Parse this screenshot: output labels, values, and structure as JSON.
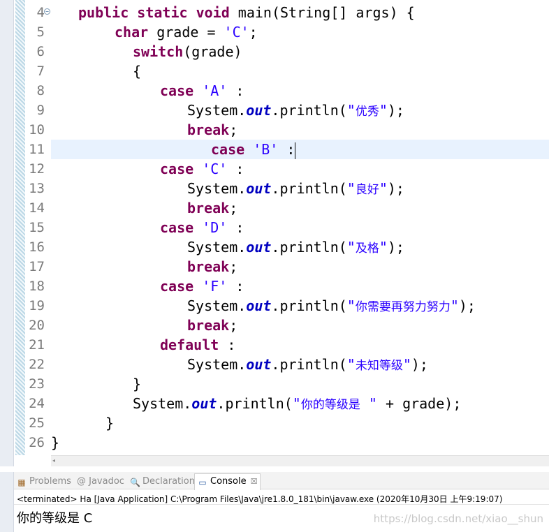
{
  "editor": {
    "lines": [
      {
        "n": "4",
        "indent": 3,
        "tokens": [
          [
            "kw",
            "public"
          ],
          [
            "p",
            " "
          ],
          [
            "kw",
            "static"
          ],
          [
            "p",
            " "
          ],
          [
            "kw",
            "void"
          ],
          [
            "p",
            " main(String[] "
          ],
          [
            "p2",
            "args"
          ],
          [
            "p",
            ") {"
          ]
        ]
      },
      {
        "n": "5",
        "indent": 7,
        "tokens": [
          [
            "kw",
            "char"
          ],
          [
            "p2",
            " grade"
          ],
          [
            "p",
            " = "
          ],
          [
            "str",
            "'C'"
          ],
          [
            "p",
            ";"
          ]
        ]
      },
      {
        "n": "6",
        "indent": 9,
        "tokens": [
          [
            "kw",
            "switch"
          ],
          [
            "p",
            "("
          ],
          [
            "p2",
            "grade"
          ],
          [
            "p",
            ")"
          ]
        ]
      },
      {
        "n": "7",
        "indent": 9,
        "tokens": [
          [
            "p",
            "{"
          ]
        ]
      },
      {
        "n": "8",
        "indent": 12,
        "tokens": [
          [
            "kw",
            "case"
          ],
          [
            "p",
            " "
          ],
          [
            "str",
            "'A'"
          ],
          [
            "p",
            " :"
          ]
        ]
      },
      {
        "n": "9",
        "indent": 15,
        "tokens": [
          [
            "p",
            "System."
          ],
          [
            "fld",
            "out"
          ],
          [
            "p",
            ".println("
          ],
          [
            "str",
            "\""
          ],
          [
            "strcn",
            "优秀"
          ],
          [
            "str",
            "\""
          ],
          [
            "p",
            ");"
          ]
        ]
      },
      {
        "n": "10",
        "indent": 15,
        "tokens": [
          [
            "kw",
            "break"
          ],
          [
            "p",
            ";"
          ]
        ]
      },
      {
        "n": "11",
        "indent": 12,
        "current": true,
        "tokens": [
          [
            "kw",
            "case"
          ],
          [
            "p",
            " "
          ],
          [
            "str",
            "'B'"
          ],
          [
            "p",
            " :"
          ]
        ]
      },
      {
        "n": "12",
        "indent": 12,
        "tokens": [
          [
            "kw",
            "case"
          ],
          [
            "p",
            " "
          ],
          [
            "str",
            "'C'"
          ],
          [
            "p",
            " :"
          ]
        ]
      },
      {
        "n": "13",
        "indent": 15,
        "tokens": [
          [
            "p",
            "System."
          ],
          [
            "fld",
            "out"
          ],
          [
            "p",
            ".println("
          ],
          [
            "str",
            "\""
          ],
          [
            "strcn",
            "良好"
          ],
          [
            "str",
            "\""
          ],
          [
            "p",
            ");"
          ]
        ]
      },
      {
        "n": "14",
        "indent": 15,
        "tokens": [
          [
            "kw",
            "break"
          ],
          [
            "p",
            ";"
          ]
        ]
      },
      {
        "n": "15",
        "indent": 12,
        "tokens": [
          [
            "kw",
            "case"
          ],
          [
            "p",
            " "
          ],
          [
            "str",
            "'D'"
          ],
          [
            "p",
            " :"
          ]
        ]
      },
      {
        "n": "16",
        "indent": 15,
        "tokens": [
          [
            "p",
            "System."
          ],
          [
            "fld",
            "out"
          ],
          [
            "p",
            ".println("
          ],
          [
            "str",
            "\""
          ],
          [
            "strcn",
            "及格"
          ],
          [
            "str",
            "\""
          ],
          [
            "p",
            ");"
          ]
        ]
      },
      {
        "n": "17",
        "indent": 15,
        "tokens": [
          [
            "kw",
            "break"
          ],
          [
            "p",
            ";"
          ]
        ]
      },
      {
        "n": "18",
        "indent": 12,
        "tokens": [
          [
            "kw",
            "case"
          ],
          [
            "p",
            " "
          ],
          [
            "str",
            "'F'"
          ],
          [
            "p",
            " :"
          ]
        ]
      },
      {
        "n": "19",
        "indent": 15,
        "tokens": [
          [
            "p",
            "System."
          ],
          [
            "fld",
            "out"
          ],
          [
            "p",
            ".println("
          ],
          [
            "str",
            "\""
          ],
          [
            "strcn",
            "你需要再努力努力"
          ],
          [
            "str",
            "\""
          ],
          [
            "p",
            ");"
          ]
        ]
      },
      {
        "n": "20",
        "indent": 15,
        "tokens": [
          [
            "kw",
            "break"
          ],
          [
            "p",
            ";"
          ]
        ]
      },
      {
        "n": "21",
        "indent": 12,
        "tokens": [
          [
            "kw",
            "default"
          ],
          [
            "p",
            " :"
          ]
        ]
      },
      {
        "n": "22",
        "indent": 15,
        "tokens": [
          [
            "p",
            "System."
          ],
          [
            "fld",
            "out"
          ],
          [
            "p",
            ".println("
          ],
          [
            "str",
            "\""
          ],
          [
            "strcn",
            "未知等级"
          ],
          [
            "str",
            "\""
          ],
          [
            "p",
            ");"
          ]
        ]
      },
      {
        "n": "23",
        "indent": 9,
        "tokens": [
          [
            "p",
            "}"
          ]
        ]
      },
      {
        "n": "24",
        "indent": 9,
        "tokens": [
          [
            "p",
            "System."
          ],
          [
            "fld",
            "out"
          ],
          [
            "p",
            ".println("
          ],
          [
            "str",
            "\""
          ],
          [
            "strcn",
            "你的等级是"
          ],
          [
            "str",
            " \""
          ],
          [
            "p",
            " + "
          ],
          [
            "p2",
            "grade"
          ],
          [
            "p",
            ");"
          ]
        ]
      },
      {
        "n": "25",
        "indent": 6,
        "tokens": [
          [
            "p",
            "}"
          ]
        ]
      },
      {
        "n": "26",
        "indent": 0,
        "tokens": [
          [
            "p",
            "}"
          ]
        ]
      }
    ],
    "fold_marker": "−",
    "scroll_left_glyph": "◂"
  },
  "panel": {
    "tabs": [
      {
        "label": "Problems",
        "icon": "problems-icon",
        "glyph": "▦",
        "color": "#a06a2a"
      },
      {
        "label": "@ Javadoc",
        "icon": "javadoc-icon",
        "glyph": "",
        "color": "#888888"
      },
      {
        "label": "Declaration",
        "icon": "declaration-icon",
        "glyph": "🔍",
        "color": "#7a7a7a"
      },
      {
        "label": "Console",
        "icon": "console-icon",
        "glyph": "▭",
        "color": "#2f5fa3",
        "active": true
      }
    ],
    "close_glyph": "☒",
    "status": "<terminated> Ha [Java Application] C:\\Program Files\\Java\\jre1.8.0_181\\bin\\javaw.exe (2020年10月30日 上午9:19:07)",
    "output": "你的等级是 C",
    "watermark": "https://blog.csdn.net/xiao__shun"
  }
}
